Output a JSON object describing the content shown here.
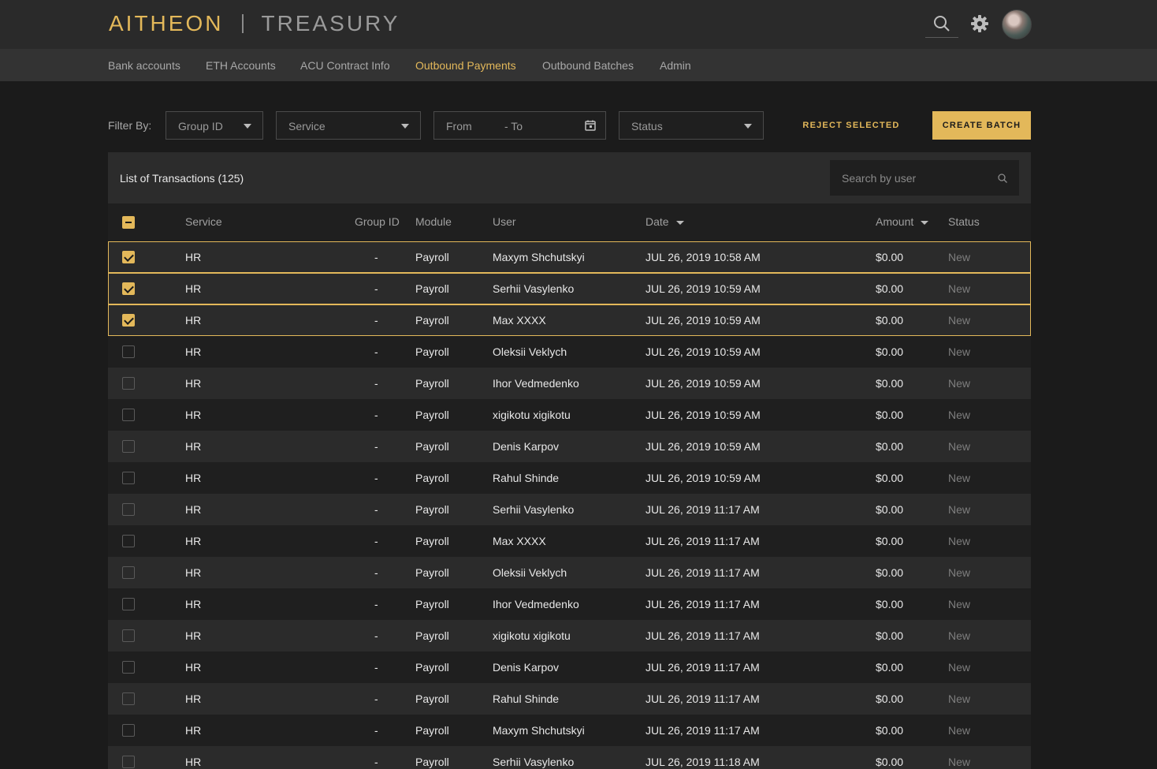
{
  "header": {
    "brand": "AITHEON",
    "module": "TREASURY",
    "icons": [
      "search-icon",
      "gear-icon",
      "avatar"
    ]
  },
  "nav": {
    "items": [
      "Bank accounts",
      "ETH Accounts",
      "ACU Contract Info",
      "Outbound Payments",
      "Outbound Batches",
      "Admin"
    ],
    "active": "Outbound Payments"
  },
  "filters": {
    "label": "Filter By:",
    "group_id": "Group ID",
    "service": "Service",
    "from": "From",
    "to": "- To",
    "status": "Status"
  },
  "actions": {
    "reject": "REJECT SELECTED",
    "create": "CREATE BATCH"
  },
  "table": {
    "title": "List of Transactions (125)",
    "search_placeholder": "Search by user",
    "columns": {
      "service": "Service",
      "group_id": "Group ID",
      "module": "Module",
      "user": "User",
      "date": "Date",
      "amount": "Amount",
      "status": "Status"
    },
    "rows": [
      {
        "checked": true,
        "service": "HR",
        "group": "-",
        "module": "Payroll",
        "user": "Maxym Shchutskyi",
        "date": "JUL 26, 2019 10:58 AM",
        "amount": "$0.00",
        "status": "New"
      },
      {
        "checked": true,
        "service": "HR",
        "group": "-",
        "module": "Payroll",
        "user": "Serhii Vasylenko",
        "date": "JUL 26, 2019 10:59 AM",
        "amount": "$0.00",
        "status": "New"
      },
      {
        "checked": true,
        "service": "HR",
        "group": "-",
        "module": "Payroll",
        "user": "Max XXXX",
        "date": "JUL 26, 2019 10:59 AM",
        "amount": "$0.00",
        "status": "New"
      },
      {
        "checked": false,
        "service": "HR",
        "group": "-",
        "module": "Payroll",
        "user": "Oleksii Veklych",
        "date": "JUL 26, 2019 10:59 AM",
        "amount": "$0.00",
        "status": "New"
      },
      {
        "checked": false,
        "service": "HR",
        "group": "-",
        "module": "Payroll",
        "user": "Ihor Vedmedenko",
        "date": "JUL 26, 2019 10:59 AM",
        "amount": "$0.00",
        "status": "New"
      },
      {
        "checked": false,
        "service": "HR",
        "group": "-",
        "module": "Payroll",
        "user": "xigikotu xigikotu",
        "date": "JUL 26, 2019 10:59 AM",
        "amount": "$0.00",
        "status": "New"
      },
      {
        "checked": false,
        "service": "HR",
        "group": "-",
        "module": "Payroll",
        "user": "Denis Karpov",
        "date": "JUL 26, 2019 10:59 AM",
        "amount": "$0.00",
        "status": "New"
      },
      {
        "checked": false,
        "service": "HR",
        "group": "-",
        "module": "Payroll",
        "user": "Rahul Shinde",
        "date": "JUL 26, 2019 10:59 AM",
        "amount": "$0.00",
        "status": "New"
      },
      {
        "checked": false,
        "service": "HR",
        "group": "-",
        "module": "Payroll",
        "user": "Serhii Vasylenko",
        "date": "JUL 26, 2019 11:17 AM",
        "amount": "$0.00",
        "status": "New"
      },
      {
        "checked": false,
        "service": "HR",
        "group": "-",
        "module": "Payroll",
        "user": "Max XXXX",
        "date": "JUL 26, 2019 11:17 AM",
        "amount": "$0.00",
        "status": "New"
      },
      {
        "checked": false,
        "service": "HR",
        "group": "-",
        "module": "Payroll",
        "user": "Oleksii Veklych",
        "date": "JUL 26, 2019 11:17 AM",
        "amount": "$0.00",
        "status": "New"
      },
      {
        "checked": false,
        "service": "HR",
        "group": "-",
        "module": "Payroll",
        "user": "Ihor Vedmedenko",
        "date": "JUL 26, 2019 11:17 AM",
        "amount": "$0.00",
        "status": "New"
      },
      {
        "checked": false,
        "service": "HR",
        "group": "-",
        "module": "Payroll",
        "user": "xigikotu xigikotu",
        "date": "JUL 26, 2019 11:17 AM",
        "amount": "$0.00",
        "status": "New"
      },
      {
        "checked": false,
        "service": "HR",
        "group": "-",
        "module": "Payroll",
        "user": "Denis Karpov",
        "date": "JUL 26, 2019 11:17 AM",
        "amount": "$0.00",
        "status": "New"
      },
      {
        "checked": false,
        "service": "HR",
        "group": "-",
        "module": "Payroll",
        "user": "Rahul Shinde",
        "date": "JUL 26, 2019 11:17 AM",
        "amount": "$0.00",
        "status": "New"
      },
      {
        "checked": false,
        "service": "HR",
        "group": "-",
        "module": "Payroll",
        "user": "Maxym Shchutskyi",
        "date": "JUL 26, 2019 11:17 AM",
        "amount": "$0.00",
        "status": "New"
      },
      {
        "checked": false,
        "service": "HR",
        "group": "-",
        "module": "Payroll",
        "user": "Serhii Vasylenko",
        "date": "JUL 26, 2019 11:18 AM",
        "amount": "$0.00",
        "status": "New"
      }
    ]
  },
  "colors": {
    "accent": "#e3b85a",
    "background": "#1b1b1b",
    "header": "#2a2a2a",
    "subnav": "#333333"
  }
}
